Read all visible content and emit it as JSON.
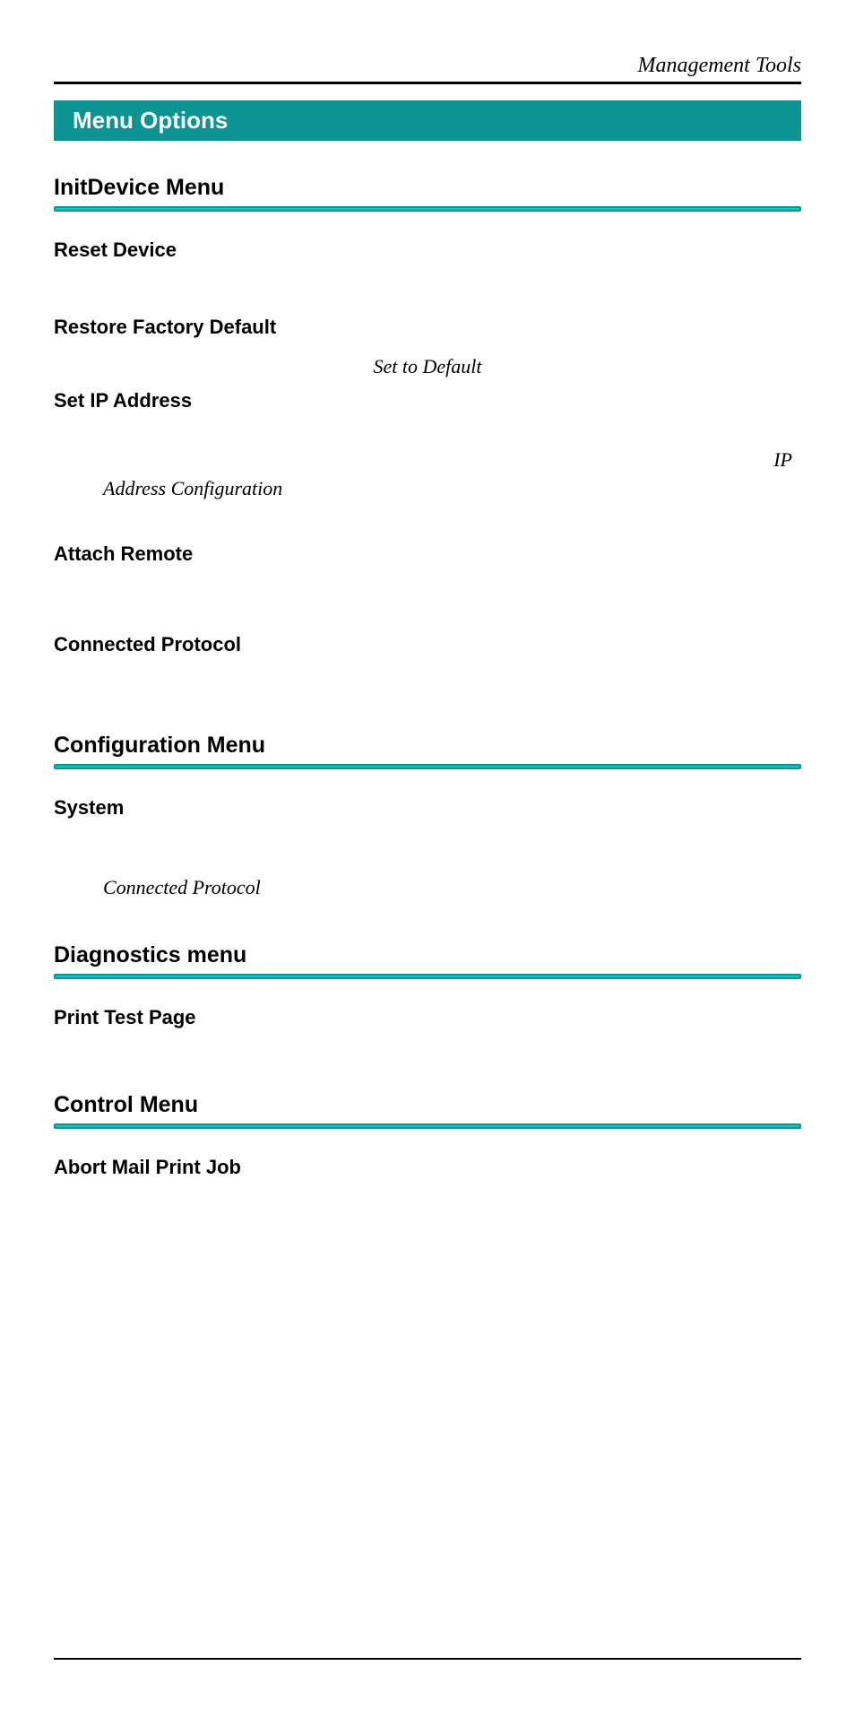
{
  "header": "Management Tools",
  "banner": "Menu Options",
  "sections": [
    {
      "title": "InitDevice Menu",
      "items": [
        {
          "title": "Reset Device"
        },
        {
          "title": "Restore Factory Default",
          "center_note": "Set to Default"
        },
        {
          "title": "Set IP Address",
          "ip_right": "IP",
          "ip_left": "Address Configuration"
        },
        {
          "title": "Attach Remote"
        },
        {
          "title": "Connected Protocol"
        }
      ]
    },
    {
      "title": "Configuration Menu",
      "items": [
        {
          "title": "System",
          "indent_note": "Connected Protocol"
        }
      ]
    },
    {
      "title": "Diagnostics menu",
      "items": [
        {
          "title": "Print Test Page"
        }
      ]
    },
    {
      "title": "Control Menu",
      "items": [
        {
          "title": "Abort Mail Print Job"
        }
      ]
    }
  ]
}
